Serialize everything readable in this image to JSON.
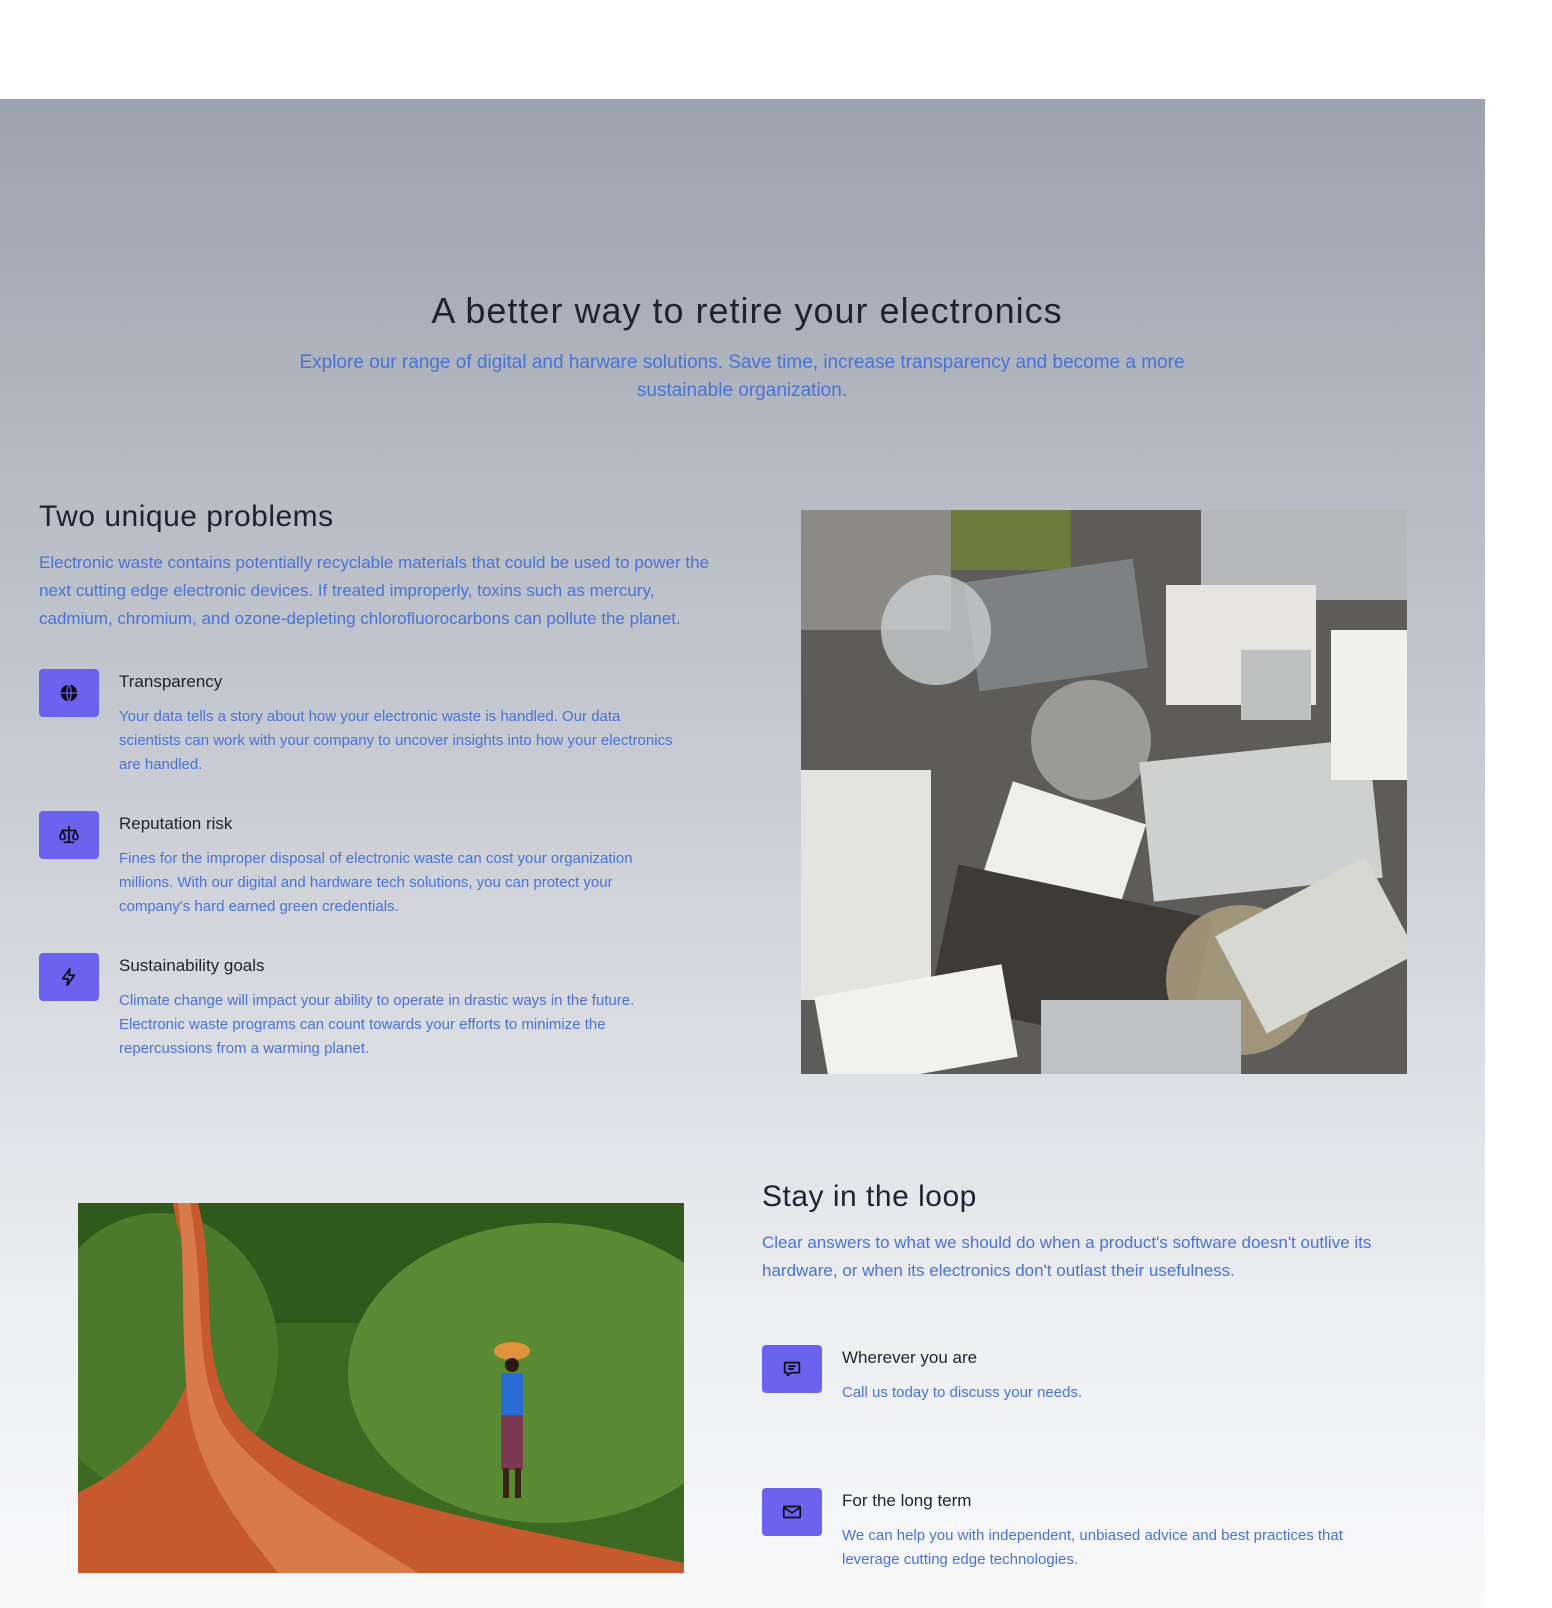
{
  "hero": {
    "title": "A better way to retire your electronics",
    "subtitle": "Explore our range of digital and harware solutions. Save time, increase transparency and become a more sustainable organization."
  },
  "problems": {
    "heading": "Two unique problems",
    "lead": "Electronic waste contains potentially recyclable materials that could be used to power the next cutting edge electronic devices.  If treated improperly, toxins such as mercury, cadmium, chromium, and ozone-depleting chlorofluorocarbons can pollute the planet.",
    "features": [
      {
        "icon": "globe-icon",
        "title": "Transparency",
        "text": "Your data tells a story about how your electronic waste is handled. Our data scientists can work with your company to uncover insights into how your electronics are handled."
      },
      {
        "icon": "scale-icon",
        "title": "Reputation risk",
        "text": "Fines for the improper disposal of electronic waste can cost your organization millions. With our digital and hardware tech solutions, you can protect your company's hard earned green credentials."
      },
      {
        "icon": "lightning-bolt-icon",
        "title": "Sustainability goals",
        "text": "Climate change will impact your ability to operate in drastic ways in the future. Electronic waste programs can count towards your efforts to minimize the repercussions from a warming planet."
      }
    ]
  },
  "loop": {
    "heading": "Stay in the loop",
    "lead": "Clear answers to what we should do when a product's software doesn't outlive its hardware, or when its electronics don't outlast their usefulness.",
    "features": [
      {
        "icon": "chat-bubble-icon",
        "title": "Wherever you are",
        "text": "Call us today to discuss your needs."
      },
      {
        "icon": "envelope-icon",
        "title": "For the long term",
        "text": "We can help you with independent, unbiased advice and best practices that leverage cutting edge technologies."
      }
    ]
  },
  "colors": {
    "accent": "#6b63f0",
    "link_text": "#4a72d4",
    "heading_text": "#1f2230"
  }
}
